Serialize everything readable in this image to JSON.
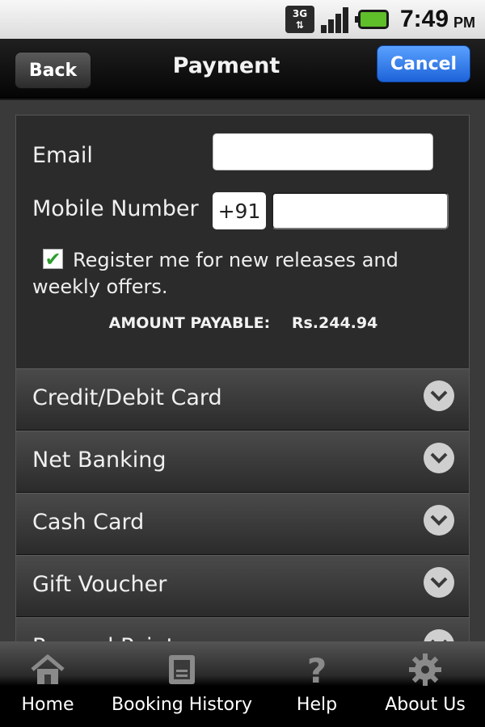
{
  "status_bar": {
    "network_label": "3G",
    "time": "7:49",
    "ampm": "PM"
  },
  "header": {
    "back_label": "Back",
    "title": "Payment",
    "cancel_label": "Cancel"
  },
  "form": {
    "email_label": "Email",
    "email_value": "",
    "mobile_label": "Mobile Number",
    "country_code": "+91",
    "mobile_value": "",
    "register_checked": true,
    "register_text": "Register me for new releases and weekly offers.",
    "amount_label": "AMOUNT PAYABLE:",
    "amount_value": "Rs.244.94"
  },
  "payment_options": [
    {
      "label": "Credit/Debit Card",
      "icon": "chevron-down-icon"
    },
    {
      "label": "Net Banking",
      "icon": "chevron-down-icon"
    },
    {
      "label": "Cash Card",
      "icon": "chevron-down-icon"
    },
    {
      "label": "Gift Voucher",
      "icon": "chevron-down-icon"
    },
    {
      "label": "Reward Points",
      "icon": "chevron-down-icon"
    }
  ],
  "bottom_nav": [
    {
      "label": "Home",
      "icon": "home-icon"
    },
    {
      "label": "Booking History",
      "icon": "booking-history-icon"
    },
    {
      "label": "Help",
      "icon": "help-icon"
    },
    {
      "label": "About Us",
      "icon": "gear-icon"
    }
  ],
  "colors": {
    "cancel_button": "#2f7ae8",
    "checkbox_check": "#2e9d2e",
    "battery": "#5fbf2a"
  }
}
